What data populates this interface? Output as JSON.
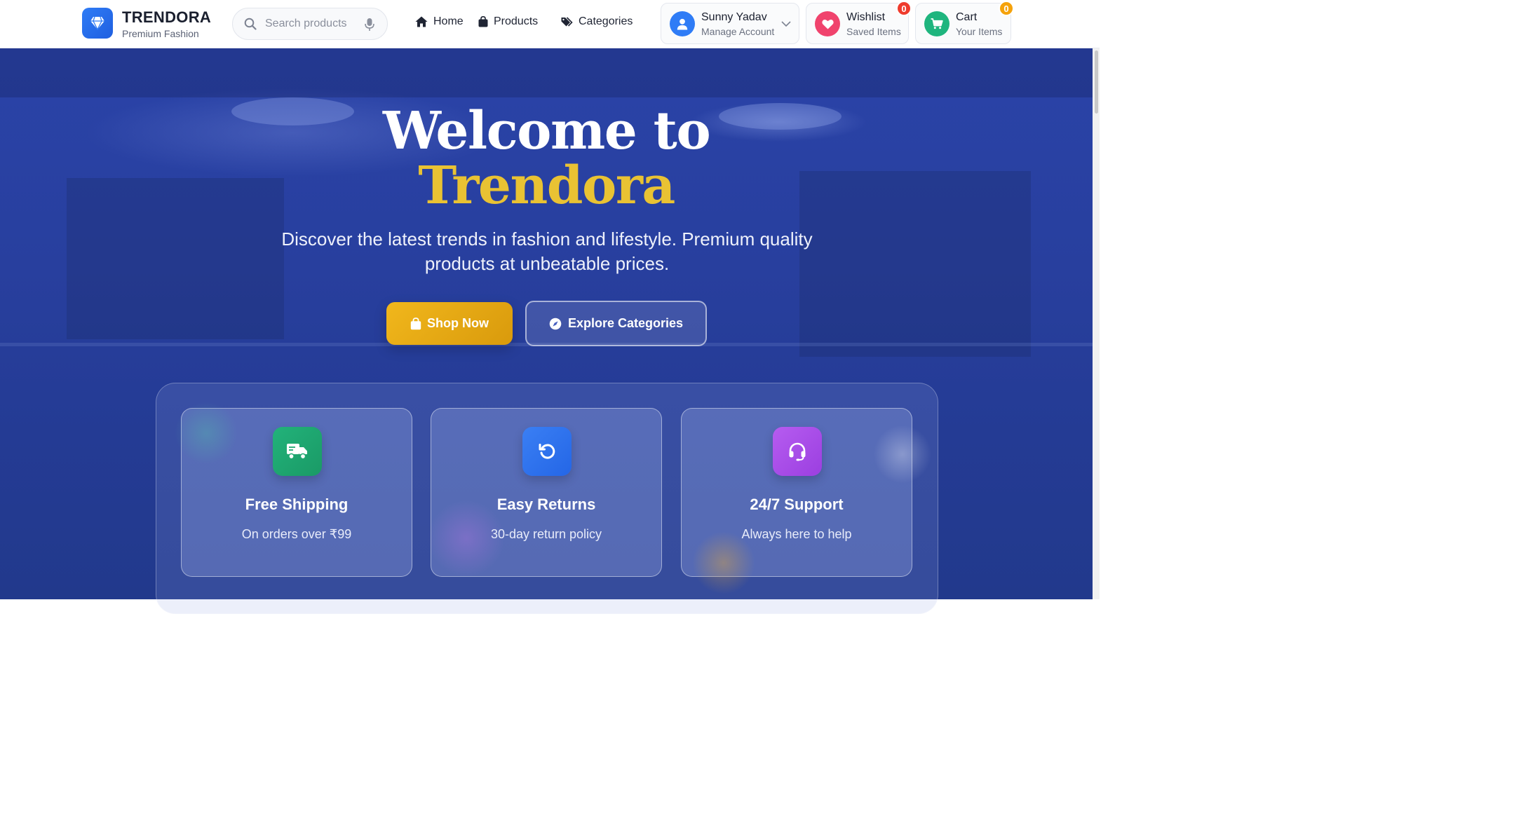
{
  "brand": {
    "name": "TRENDORA",
    "tagline": "Premium Fashion",
    "logo_icon": "diamond-icon"
  },
  "search": {
    "placeholder": "Search products",
    "value": ""
  },
  "nav": [
    {
      "label": "Home",
      "icon": "home-icon"
    },
    {
      "label": "Products",
      "icon": "shopping-bag-icon"
    },
    {
      "label": "Categories",
      "icon": "tags-icon"
    }
  ],
  "account": {
    "name": "Sunny Yadav",
    "subtitle": "Manage Account",
    "icon": "user-icon"
  },
  "wishlist": {
    "title": "Wishlist",
    "subtitle": "Saved Items",
    "count": "0",
    "icon": "heart-icon"
  },
  "cart": {
    "title": "Cart",
    "subtitle": "Your Items",
    "count": "0",
    "icon": "cart-icon"
  },
  "hero": {
    "title_line1": "Welcome to",
    "title_line2": "Trendora",
    "subtitle": "Discover the latest trends in fashion and lifestyle. Premium quality products at unbeatable prices.",
    "primary_button": "Shop Now",
    "secondary_button": "Explore Categories"
  },
  "features": [
    {
      "title": "Free Shipping",
      "desc": "On orders over ₹99",
      "icon": "truck-icon"
    },
    {
      "title": "Easy Returns",
      "desc": "30-day return policy",
      "icon": "undo-icon"
    },
    {
      "title": "24/7 Support",
      "desc": "Always here to help",
      "icon": "headset-icon"
    }
  ],
  "colors": {
    "brand_blue": "#2f7cf6",
    "hero_blue": "#283f9e",
    "gold": "#e9c233",
    "wishlist_pink": "#f0436d",
    "cart_green": "#1fb57e",
    "badge_red": "#ef3b2d",
    "badge_orange": "#f5a20b",
    "support_purple": "#a84ee8"
  }
}
